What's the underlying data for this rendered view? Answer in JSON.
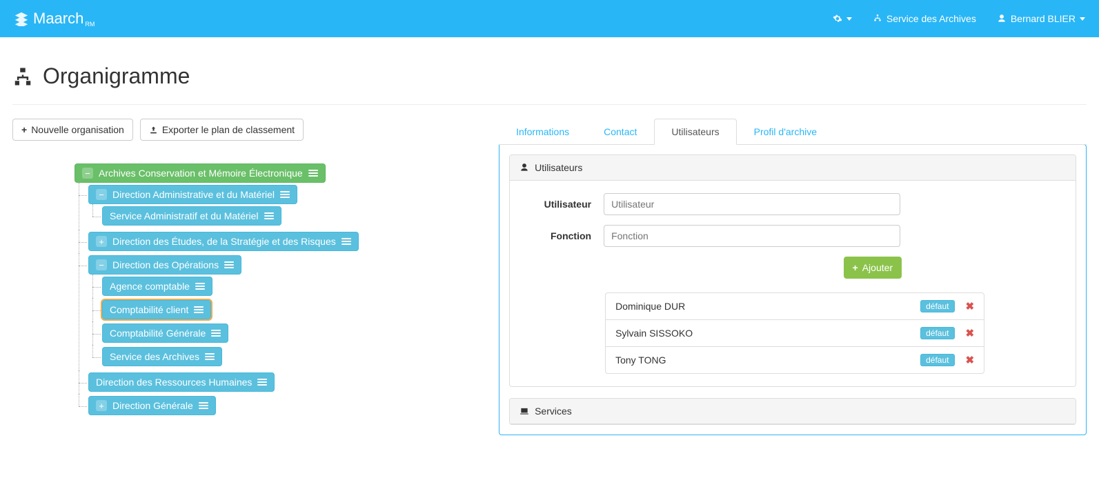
{
  "navbar": {
    "brand": "Maarch",
    "brand_sub": "RM",
    "service_label": "Service des Archives",
    "user_label": "Bernard BLIER"
  },
  "page": {
    "title": "Organigramme"
  },
  "toolbar": {
    "new_org": "Nouvelle organisation",
    "export_plan": "Exporter le plan de classement"
  },
  "tree": {
    "root": {
      "label": "Archives Conservation et Mémoire Électronique",
      "icon": "minus",
      "color": "green"
    },
    "children": [
      {
        "label": "Direction Administrative et du Matériel",
        "icon": "minus",
        "children": [
          {
            "label": "Service Administratif et du Matériel",
            "icon": ""
          }
        ]
      },
      {
        "label": "Direction des Études, de la Stratégie et des Risques",
        "icon": "plus"
      },
      {
        "label": "Direction des Opérations",
        "icon": "minus",
        "children": [
          {
            "label": "Agence comptable",
            "icon": ""
          },
          {
            "label": "Comptabilité client",
            "icon": "",
            "selected": true
          },
          {
            "label": "Comptabilité Générale",
            "icon": ""
          },
          {
            "label": "Service des Archives",
            "icon": ""
          }
        ]
      },
      {
        "label": "Direction des Ressources Humaines",
        "icon": ""
      },
      {
        "label": "Direction Générale",
        "icon": "plus"
      }
    ]
  },
  "tabs": {
    "informations": "Informations",
    "contact": "Contact",
    "utilisateurs": "Utilisateurs",
    "profil": "Profil d'archive"
  },
  "panel": {
    "users_heading": "Utilisateurs",
    "services_heading": "Services",
    "user_label": "Utilisateur",
    "user_placeholder": "Utilisateur",
    "function_label": "Fonction",
    "function_placeholder": "Fonction",
    "add_button": "Ajouter",
    "default_badge": "défaut",
    "users": [
      {
        "name": "Dominique DUR"
      },
      {
        "name": "Sylvain SISSOKO"
      },
      {
        "name": "Tony TONG"
      }
    ]
  }
}
